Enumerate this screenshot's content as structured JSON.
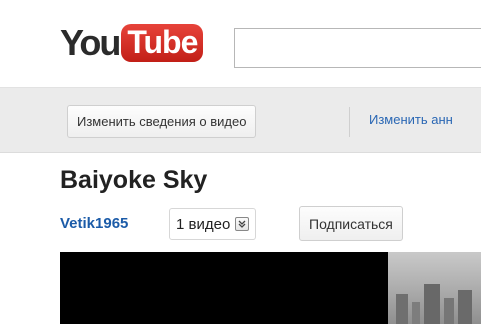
{
  "header": {
    "logo": {
      "you": "You",
      "tube": "Tube"
    },
    "search": {
      "value": "",
      "placeholder": ""
    }
  },
  "toolbar": {
    "edit_details_label": "Изменить сведения о видео",
    "edit_annotations_label": "Изменить анн"
  },
  "video": {
    "title": "Baiyoke Sky",
    "channel": "Vetik1965",
    "video_count": "1 видео",
    "subscribe_label": "Подписаться"
  },
  "colors": {
    "brand_red": "#d22b22",
    "link_blue": "#2a67b4",
    "channel_blue": "#1b5ba8",
    "toolbar_bg": "#ebebeb"
  },
  "icons": {
    "expand": "chevron-down-icon"
  }
}
